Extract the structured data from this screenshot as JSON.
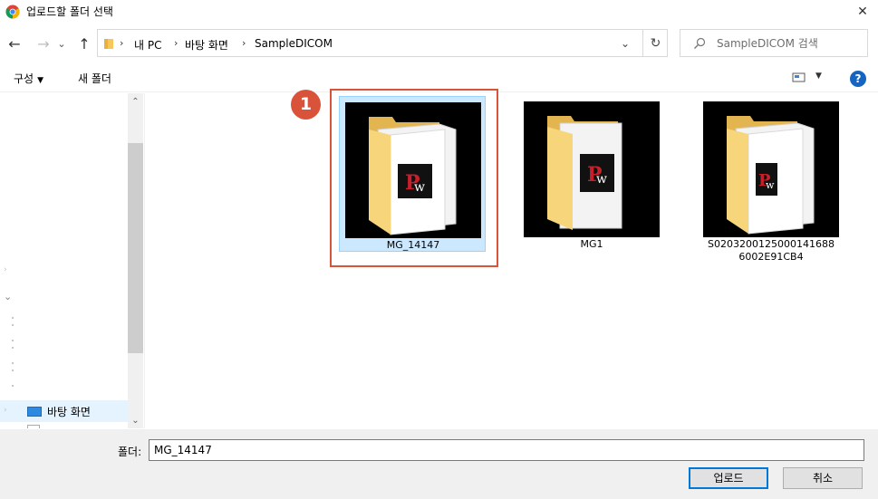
{
  "window": {
    "title": "업로드할 폴더 선택",
    "close_glyph": "✕"
  },
  "nav": {
    "back_glyph": "←",
    "forward_glyph": "→",
    "recent_glyph": "⌄",
    "up_glyph": "↑",
    "breadcrumbs": [
      "내 PC",
      "바탕 화면",
      "SampleDICOM"
    ],
    "crumb_sep": "›",
    "dropdown_glyph": "⌄",
    "refresh_glyph": "↻"
  },
  "search": {
    "placeholder": "SampleDICOM 검색"
  },
  "commands": {
    "organize_label": "구성",
    "organize_caret": "▼",
    "new_folder_label": "새 폴더",
    "view_caret": "▼",
    "help_glyph": "?"
  },
  "navpane": {
    "selected_item": "바탕 화면",
    "scroll_up": "⌃",
    "scroll_down": "⌄"
  },
  "files": [
    {
      "name": "MG_14147",
      "selected": true
    },
    {
      "name": "MG1",
      "selected": false
    },
    {
      "name": "S0203200125000141688 6002E91CB4",
      "name_line1": "S0203200125000141688",
      "name_line2": "6002E91CB4",
      "selected": false
    }
  ],
  "annotation": {
    "badge": "1",
    "color": "#d9533a"
  },
  "footer": {
    "folder_label": "폴더:",
    "folder_value": "MG_14147",
    "upload_label": "업로드",
    "cancel_label": "취소"
  }
}
